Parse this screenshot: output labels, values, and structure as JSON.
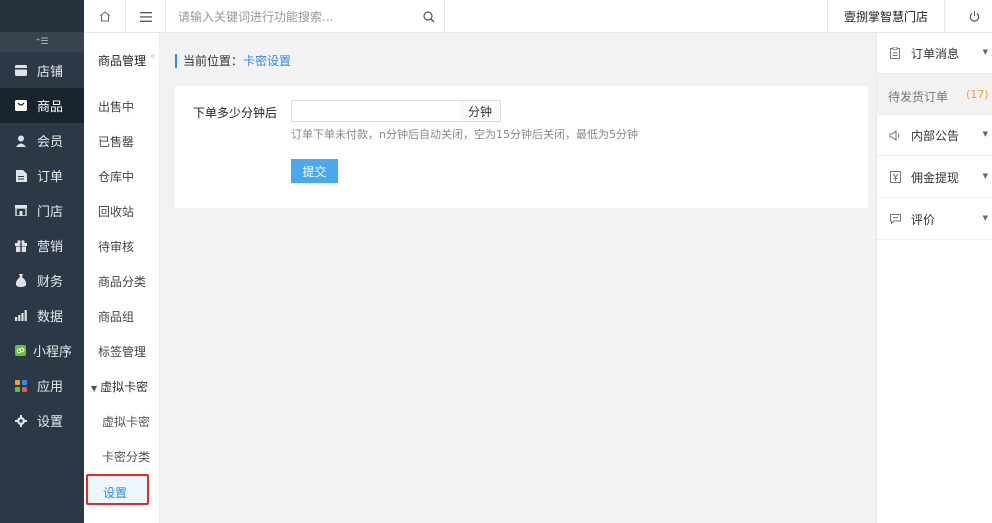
{
  "sidebar": {
    "collapse_icon": "menu-collapse-icon",
    "items": [
      {
        "label": "店铺",
        "icon": "store-icon"
      },
      {
        "label": "商品",
        "icon": "goods-icon"
      },
      {
        "label": "会员",
        "icon": "member-icon"
      },
      {
        "label": "订单",
        "icon": "order-icon"
      },
      {
        "label": "门店",
        "icon": "shop-icon"
      },
      {
        "label": "营销",
        "icon": "gift-icon"
      },
      {
        "label": "财务",
        "icon": "money-bag-icon"
      },
      {
        "label": "数据",
        "icon": "chart-icon"
      },
      {
        "label": "小程序",
        "icon": "miniapp-icon"
      },
      {
        "label": "应用",
        "icon": "apps-icon"
      },
      {
        "label": "设置",
        "icon": "gear-icon"
      }
    ],
    "active_index": 1
  },
  "submenu": {
    "title": "商品管理",
    "collapse_glyph": "«",
    "items": [
      "出售中",
      "已售罄",
      "仓库中",
      "回收站",
      "待审核",
      "商品分类",
      "商品组",
      "标签管理"
    ],
    "group": "虚拟卡密",
    "group_children": [
      "虚拟卡密",
      "卡密分类"
    ],
    "active": "设置"
  },
  "topbar": {
    "search_placeholder": "请输入关键词进行功能搜索...",
    "shop_name": "壹捌掌智慧门店"
  },
  "breadcrumb": {
    "prefix": "当前位置：",
    "current": "卡密设置"
  },
  "form": {
    "label": "下单多少分钟后",
    "value": "",
    "unit": "分钟",
    "help": "订单下单未付款，n分钟后自动关闭，空为15分钟后关闭，最低为5分钟",
    "submit_label": "提交"
  },
  "right_panel": {
    "items": [
      {
        "label": "订单消息",
        "icon": "clipboard-icon"
      },
      {
        "label": "内部公告",
        "icon": "speaker-icon"
      },
      {
        "label": "佣金提现",
        "icon": "withdraw-icon"
      },
      {
        "label": "评价",
        "icon": "comment-icon"
      }
    ],
    "pending": {
      "label": "待发货订单",
      "count": "(17)"
    }
  },
  "colors": {
    "sidebar_bg": "#2b3845",
    "accent": "#2d8cf0",
    "submit": "#4aa8ee",
    "highlight_border": "#e22a2a",
    "count": "#f0a030"
  }
}
